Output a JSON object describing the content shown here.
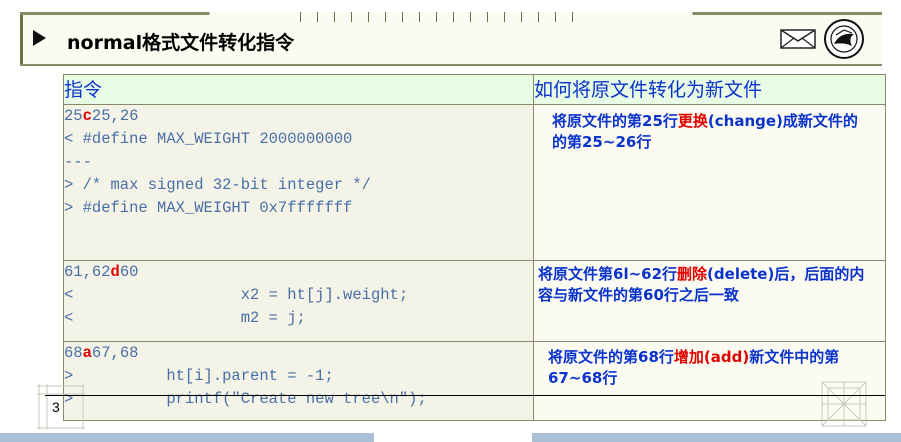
{
  "header": {
    "title": "normal格式文件转化指令"
  },
  "table": {
    "head": {
      "col1": "指令",
      "col2": "如何将原文件转化为新文件"
    },
    "rows": [
      {
        "code": [
          {
            "pre": "25",
            "cmd": "c",
            "post": "25,26"
          },
          {
            "text": "< #define MAX_WEIGHT 2000000000"
          },
          {
            "text": "---"
          },
          {
            "text": "> /* max signed 32-bit integer */"
          },
          {
            "text": "> #define MAX_WEIGHT 0x7fffffff"
          }
        ],
        "desc": {
          "before": "将原文件的第25行",
          "highlight": "更换",
          "after": "(change)成新文件的的第25~26行"
        }
      },
      {
        "code": [
          {
            "pre": "61,62",
            "cmd": "d",
            "post": "60"
          },
          {
            "text": "<                  x2 = ht[j].weight;"
          },
          {
            "text": "<                  m2 = j;"
          }
        ],
        "desc": {
          "before": "将原文件第6l~62行",
          "highlight": "删除",
          "after": "(delete)后，后面的内容与新文件的第60行之后一致"
        }
      },
      {
        "code": [
          {
            "pre": "68",
            "cmd": "a",
            "post": "67,68"
          },
          {
            "text": ">          ht[i].parent = -1;"
          },
          {
            "text": ">          printf(\"Create new tree\\n\");"
          }
        ],
        "desc": {
          "before": "将原文件的第68行",
          "highlight": "增加(add)",
          "after": "新文件中的第67~68行"
        }
      }
    ]
  },
  "footer": {
    "slide_number": "3"
  },
  "icons": {
    "mail": "envelope-icon",
    "logo": "university-seal-icon"
  },
  "colors": {
    "header_text": "#0b33cc",
    "command_red": "#e00000",
    "code_text": "#4a6fa5",
    "table_header_bg": "#e8fbe5"
  }
}
